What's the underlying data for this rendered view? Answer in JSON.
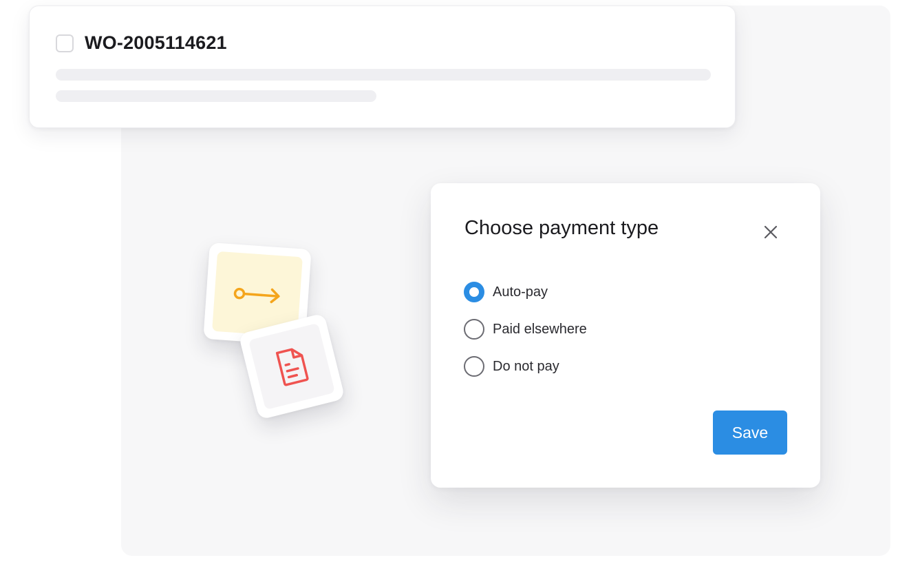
{
  "work_order": {
    "id": "WO-2005114621"
  },
  "modal": {
    "title": "Choose payment type",
    "options": [
      {
        "label": "Auto-pay",
        "checked": true
      },
      {
        "label": "Paid elsewhere",
        "checked": false
      },
      {
        "label": "Do not pay",
        "checked": false
      }
    ],
    "save_label": "Save"
  },
  "icons": {
    "close": "close-icon",
    "transfer": "key-arrow-icon",
    "document": "document-icon"
  },
  "colors": {
    "accent": "#2b8de3",
    "transfer_icon": "#f4a51c",
    "document_icon": "#ef5350",
    "transfer_tile_bg": "#fdf6d8"
  }
}
